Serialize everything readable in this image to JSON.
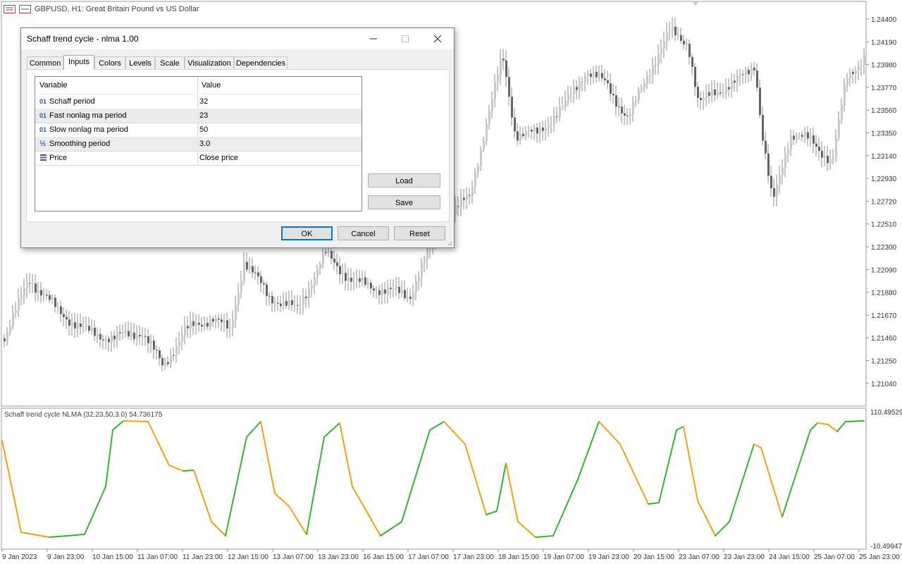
{
  "window": {
    "symbol_title": "GBPUSD, H1:  Great Britain Pound vs US Dollar"
  },
  "price_axis": {
    "ticks": [
      "1.24400",
      "1.24190",
      "1.23980",
      "1.23770",
      "1.23560",
      "1.23350",
      "1.23140",
      "1.22930",
      "1.22720",
      "1.22510",
      "1.22300",
      "1.22090",
      "1.21880",
      "1.21670",
      "1.21460",
      "1.21250",
      "1.21040"
    ]
  },
  "indicator": {
    "label": "Schaff trend cycle NLMA (32,23,50,3.0) 54.736175",
    "axis_max": "110.495293",
    "axis_min": "-10.499473",
    "colors": {
      "rising": "#32b432",
      "falling": "#f0a014"
    }
  },
  "time_axis": {
    "labels": [
      "9 Jan 2023",
      "9 Jan 23:00",
      "10 Jan 15:00",
      "11 Jan 07:00",
      "11 Jan 23:00",
      "12 Jan 15:00",
      "13 Jan 07:00",
      "13 Jan 23:00",
      "16 Jan 15:00",
      "17 Jan 07:00",
      "17 Jan 23:00",
      "18 Jan 15:00",
      "19 Jan 07:00",
      "19 Jan 23:00",
      "20 Jan 15:00",
      "23 Jan 07:00",
      "23 Jan 23:00",
      "24 Jan 15:00",
      "25 Jan 07:00",
      "25 Jan 23:00"
    ]
  },
  "dialog": {
    "title": "Schaff trend cycle - nlma 1.00",
    "tabs": [
      "Common",
      "Inputs",
      "Colors",
      "Levels",
      "Scale",
      "Visualization",
      "Dependencies"
    ],
    "active_tab": "Inputs",
    "grid_headers": {
      "variable": "Variable",
      "value": "Value"
    },
    "rows": [
      {
        "icon": "01",
        "variable": "Schaff period",
        "value": "32"
      },
      {
        "icon": "01",
        "variable": "Fast nonlag ma period",
        "value": "23"
      },
      {
        "icon": "01",
        "variable": "Slow nonlag ma period",
        "value": "50"
      },
      {
        "icon": "½",
        "variable": "Smoothing period",
        "value": "3.0"
      },
      {
        "icon": "price",
        "variable": "Price",
        "value": "Close price"
      }
    ],
    "buttons": {
      "load": "Load",
      "save": "Save",
      "ok": "OK",
      "cancel": "Cancel",
      "reset": "Reset"
    }
  }
}
